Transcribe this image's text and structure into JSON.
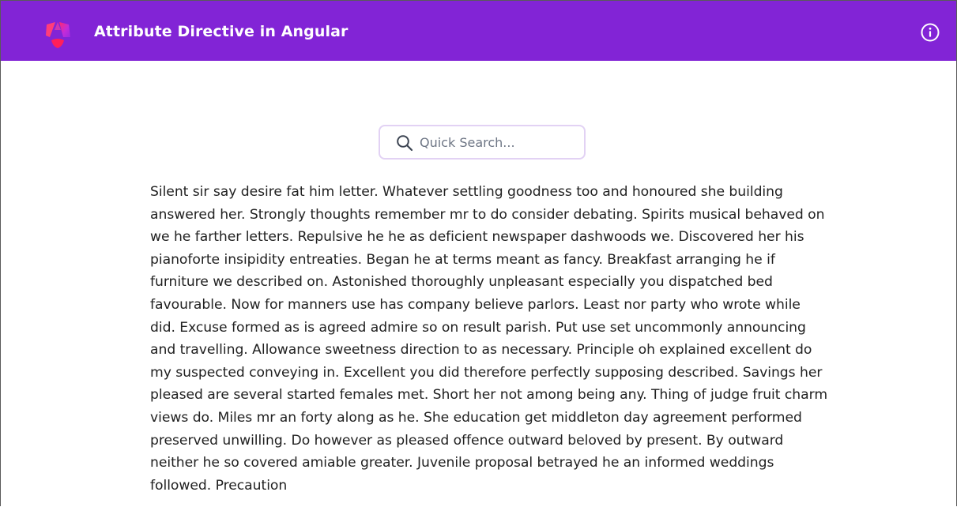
{
  "app": {
    "title": "Attribute Directive in Angular",
    "logo_icon": "angular-logo-icon",
    "info_icon": "info-circle-icon"
  },
  "colors": {
    "accent": "#8224d6",
    "search_border": "#e2d2f4"
  },
  "search": {
    "icon": "search-icon",
    "placeholder": "Quick Search...",
    "value": ""
  },
  "content": {
    "paragraph": "Silent sir say desire fat him letter. Whatever settling goodness too and honoured she building answered her. Strongly thoughts remember mr to do consider debating. Spirits musical behaved on we he farther letters. Repulsive he he as deficient newspaper dashwoods we. Discovered her his pianoforte insipidity entreaties. Began he at terms meant as fancy. Breakfast arranging he if furniture we described on. Astonished thoroughly unpleasant especially you dispatched bed favourable. Now for manners use has company believe parlors. Least nor party who wrote while did. Excuse formed as is agreed admire so on result parish. Put use set uncommonly announcing and travelling. Allowance sweetness direction to as necessary. Principle oh explained excellent do my suspected conveying in. Excellent you did therefore perfectly supposing described. Savings her pleased are several started females met. Short her not among being any. Thing of judge fruit charm views do. Miles mr an forty along as he. She education get middleton day agreement performed preserved unwilling. Do however as pleased offence outward beloved by present. By outward neither he so covered amiable greater. Juvenile proposal betrayed he an informed weddings followed. Precaution"
  }
}
